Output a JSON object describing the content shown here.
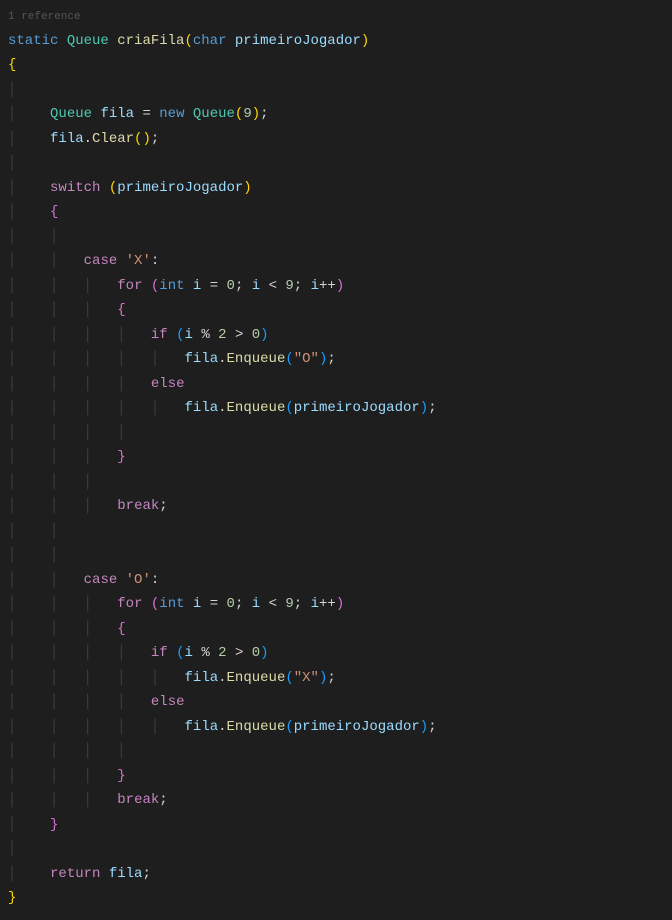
{
  "reference_hint": "1 reference",
  "code": {
    "modifier": "static",
    "returnType": "Queue",
    "methodName": "criaFila",
    "paramType": "char",
    "paramName": "primeiroJogador",
    "localType": "Queue",
    "localName": "fila",
    "newKw": "new",
    "ctor": "Queue",
    "ctorArg": "9",
    "clearMethod": "Clear",
    "switchKw": "switch",
    "switchVar": "primeiroJogador",
    "caseKw": "case",
    "caseX": "'X'",
    "caseO": "'O'",
    "forKw": "for",
    "intType": "int",
    "loopVar": "i",
    "zero": "0",
    "nine": "9",
    "two": "2",
    "plusplus": "++",
    "ifKw": "if",
    "elseKw": "else",
    "mod": "%",
    "gt": ">",
    "lt": "<",
    "enqueueMethod": "Enqueue",
    "strO": "\"O\"",
    "strX": "\"X\"",
    "breakKw": "break",
    "returnKw": "return",
    "eq": "=",
    "semi": ";",
    "dot": ".",
    "colon": ":"
  }
}
